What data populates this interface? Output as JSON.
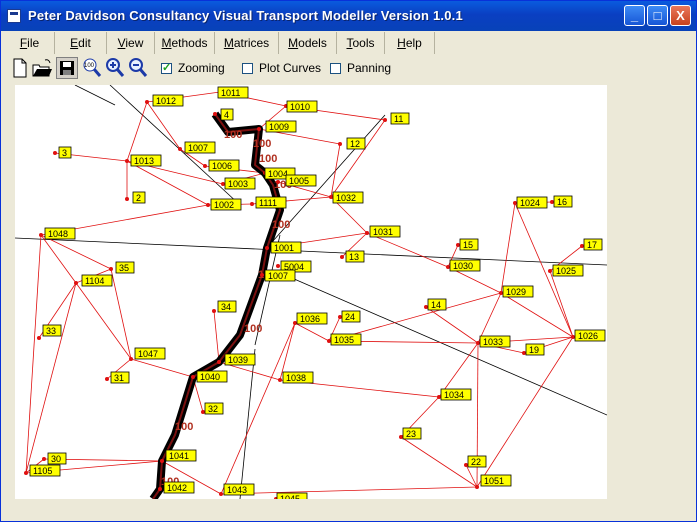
{
  "window": {
    "title": "Peter Davidson  Consultancy Visual Transport Modeller Version 1.0.1",
    "controls": [
      "_",
      "□",
      "X"
    ]
  },
  "menu": [
    {
      "label": "File",
      "underline": "F",
      "rest": "ile"
    },
    {
      "label": "Edit",
      "underline": "E",
      "rest": "dit"
    },
    {
      "label": "View",
      "underline": "V",
      "rest": "iew"
    },
    {
      "label": "Methods",
      "underline": "M",
      "rest": "ethods"
    },
    {
      "label": "Matrices",
      "underline": "M",
      "rest": "atrices"
    },
    {
      "label": "Models",
      "underline": "M",
      "rest": "odels"
    },
    {
      "label": "Tools",
      "underline": "T",
      "rest": "ools"
    },
    {
      "label": "Help",
      "underline": "H",
      "rest": "elp"
    }
  ],
  "toolbar": {
    "buttons": [
      "new-file-icon",
      "open-folder-icon",
      "save-disk-icon",
      "zoom-100-icon",
      "zoom-in-icon",
      "zoom-out-icon"
    ],
    "zoom_100_label": "100",
    "checkboxes": [
      {
        "label": "Zooming",
        "checked": true
      },
      {
        "label": "Plot Curves",
        "checked": false
      },
      {
        "label": "Panning",
        "checked": false
      }
    ]
  },
  "colors": {
    "link": "#e01010",
    "road": "#000000",
    "path": "#000000",
    "node_fill": "#ffff00",
    "flow_text": "#b03020"
  },
  "map": {
    "flow_value": "100",
    "nodes": [
      {
        "id": "1011"
      },
      {
        "id": "1012"
      },
      {
        "id": "4"
      },
      {
        "id": "1010"
      },
      {
        "id": "11"
      },
      {
        "id": "1009"
      },
      {
        "id": "12"
      },
      {
        "id": "3"
      },
      {
        "id": "1013"
      },
      {
        "id": "1007"
      },
      {
        "id": "1006"
      },
      {
        "id": "1004"
      },
      {
        "id": "1005"
      },
      {
        "id": "1003"
      },
      {
        "id": "2"
      },
      {
        "id": "1002"
      },
      {
        "id": "1111"
      },
      {
        "id": "1032"
      },
      {
        "id": "1024"
      },
      {
        "id": "16"
      },
      {
        "id": "1048"
      },
      {
        "id": "1031"
      },
      {
        "id": "15"
      },
      {
        "id": "17"
      },
      {
        "id": "1001"
      },
      {
        "id": "13"
      },
      {
        "id": "1030"
      },
      {
        "id": "1025"
      },
      {
        "id": "35"
      },
      {
        "id": "5004"
      },
      {
        "id": "1104"
      },
      {
        "id": "1007b"
      },
      {
        "id": "1029"
      },
      {
        "id": "14"
      },
      {
        "id": "34"
      },
      {
        "id": "24"
      },
      {
        "id": "1036"
      },
      {
        "id": "33"
      },
      {
        "id": "1035"
      },
      {
        "id": "1033"
      },
      {
        "id": "1026"
      },
      {
        "id": "19"
      },
      {
        "id": "1047"
      },
      {
        "id": "1039"
      },
      {
        "id": "31"
      },
      {
        "id": "1040"
      },
      {
        "id": "1038"
      },
      {
        "id": "1034"
      },
      {
        "id": "32"
      },
      {
        "id": "23"
      },
      {
        "id": "1041"
      },
      {
        "id": "30"
      },
      {
        "id": "22"
      },
      {
        "id": "1105"
      },
      {
        "id": "1051"
      },
      {
        "id": "1042"
      },
      {
        "id": "1043"
      },
      {
        "id": "1045"
      }
    ],
    "labels": {
      "1011": "1011",
      "1012": "1012",
      "4": "4",
      "1010": "1010",
      "11": "11",
      "1009": "1009",
      "12": "12",
      "3": "3",
      "1013": "1013",
      "1007": "1007",
      "1006": "1006",
      "1004": "1004",
      "1005": "1005",
      "1003": "1003",
      "2": "2",
      "1002": "1002",
      "1111": "1111",
      "1032": "1032",
      "1024": "1024",
      "16": "16",
      "1048": "1048",
      "1031": "1031",
      "15": "15",
      "17": "17",
      "1001": "1001",
      "13": "13",
      "1030": "1030",
      "1025": "1025",
      "35": "35",
      "5004": "5004",
      "1104": "1104",
      "1007b": "1007",
      "1029": "1029",
      "14": "14",
      "34": "34",
      "24": "24",
      "1036": "1036",
      "33": "33",
      "1035": "1035",
      "1033": "1033",
      "1026": "1026",
      "19": "19",
      "1047": "1047",
      "1039": "1039",
      "31": "31",
      "1040": "1040",
      "1038": "1038",
      "1034": "1034",
      "32": "32",
      "23": "23",
      "1041": "1041",
      "30": "30",
      "22": "22",
      "1105": "1105",
      "1051": "1051",
      "1042": "1042",
      "1043": "1043",
      "1045": "1045"
    }
  }
}
